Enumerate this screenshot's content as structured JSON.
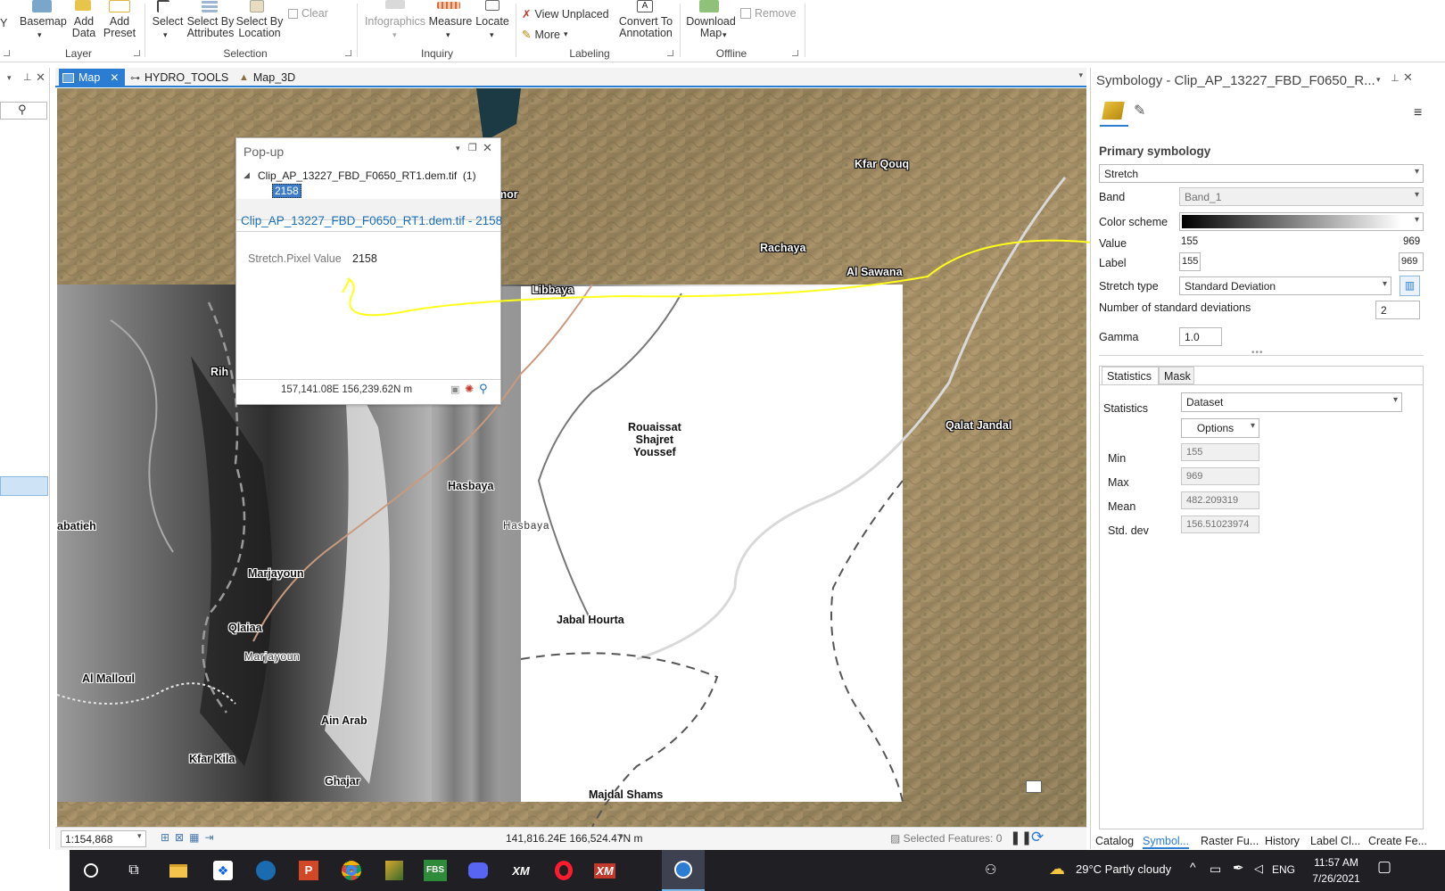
{
  "ribbon": {
    "layer_group": {
      "label": "Layer",
      "basemap": "Basemap",
      "add_data": "Add\nData",
      "add_preset": "Add\nPreset"
    },
    "selection_group": {
      "label": "Selection",
      "select": "Select",
      "select_by_attributes": "Select By\nAttributes",
      "select_by_location": "Select By\nLocation",
      "clear": "Clear"
    },
    "inquiry_group": {
      "label": "Inquiry",
      "infographics": "Infographics",
      "measure": "Measure",
      "locate": "Locate"
    },
    "labeling_group": {
      "label": "Labeling",
      "view_unplaced": "View Unplaced",
      "more": "More",
      "convert_to_annotation": "Convert To\nAnnotation"
    },
    "offline_group": {
      "label": "Offline",
      "download_map": "Download\nMap",
      "remove": "Remove"
    },
    "clipped_left": "Y"
  },
  "tabs": [
    {
      "label": "Map"
    },
    {
      "label": "HYDRO_TOOLS"
    },
    {
      "label": "Map_3D"
    }
  ],
  "map": {
    "places": [
      {
        "name": "Kfar Qouq"
      },
      {
        "name": "Rachaya"
      },
      {
        "name": "Al Sawana"
      },
      {
        "name": "Libbaya"
      },
      {
        "name": "amor"
      },
      {
        "name": "Rih"
      },
      {
        "name": "Qalat Jandal"
      },
      {
        "name": "Rouaissat\nShajret\nYoussef"
      },
      {
        "name": "Hasbaya"
      },
      {
        "name": "Hasbaya"
      },
      {
        "name": "abatieh"
      },
      {
        "name": "Marjayoun"
      },
      {
        "name": "Qlaiaa"
      },
      {
        "name": "Marjayoun"
      },
      {
        "name": "Jabal Hourta"
      },
      {
        "name": "Al Malloul"
      },
      {
        "name": "Ain Arab"
      },
      {
        "name": "Kfar Kila"
      },
      {
        "name": "Ghajar"
      },
      {
        "name": "Majdal Shams"
      }
    ]
  },
  "popup": {
    "title": "Pop-up",
    "tree_item": "Clip_AP_13227_FBD_F0650_RT1.dem.tif  (1)",
    "tree_value": "2158",
    "header": "Clip_AP_13227_FBD_F0650_RT1.dem.tif - 2158",
    "field_label": "Stretch.Pixel Value",
    "field_value": "2158",
    "coords": "157,141.08E 156,239.62N m"
  },
  "status": {
    "scale": "1:154,868",
    "coords": "141,816.24E 166,524.47N m",
    "selected": "Selected Features: 0"
  },
  "symbology": {
    "title": "Symbology - Clip_AP_13227_FBD_F0650_R...",
    "primary": "Primary symbology",
    "renderer": "Stretch",
    "band_label": "Band",
    "band_value": "Band_1",
    "color_scheme_label": "Color scheme",
    "value_label": "Value",
    "value_min": "155",
    "value_max": "969",
    "label_label": "Label",
    "label_min": "155",
    "label_max": "969",
    "stretch_type_label": "Stretch type",
    "stretch_type_value": "Standard Deviation",
    "num_std_label": "Number of standard deviations",
    "num_std_value": "2",
    "gamma_label": "Gamma",
    "gamma_value": "1.0",
    "tab_statistics": "Statistics",
    "tab_mask": "Mask",
    "statistics_label": "Statistics",
    "statistics_value": "Dataset",
    "options": "Options",
    "min_label": "Min",
    "min_value": "155",
    "max_label": "Max",
    "max_value": "969",
    "mean_label": "Mean",
    "mean_value": "482.209319",
    "std_label": "Std. dev",
    "std_value": "156.51023974"
  },
  "bottom_tabs": [
    "Catalog",
    "Symbol...",
    "Raster Fu...",
    "History",
    "Label Cl...",
    "Create Fe..."
  ],
  "taskbar": {
    "weather": "29°C  Partly cloudy",
    "lang": "ENG",
    "time": "11:57 AM",
    "date": "7/26/2021"
  },
  "colors": {
    "accent": "#2b7cd3",
    "link": "#1a6fb8",
    "annotation": "#ffff1a"
  }
}
